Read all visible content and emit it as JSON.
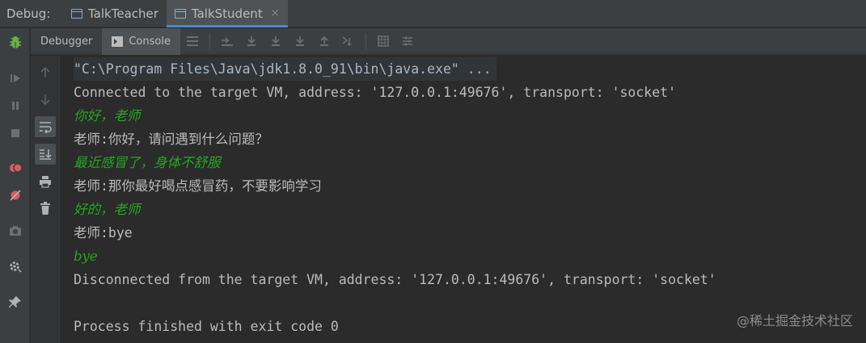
{
  "topbar": {
    "label": "Debug:",
    "tabs": [
      {
        "title": "TalkTeacher",
        "active": false,
        "closable": false
      },
      {
        "title": "TalkStudent",
        "active": true,
        "closable": true
      }
    ],
    "close_glyph": "×"
  },
  "toolbar": {
    "debugger_label": "Debugger",
    "console_label": "Console",
    "icons": [
      "menu-icon",
      "show-execution-point-icon",
      "step-over-icon",
      "step-into-icon",
      "force-step-into-icon",
      "step-out-icon",
      "run-to-cursor-icon",
      "evaluate-expression-icon",
      "trace-icon"
    ]
  },
  "leftbar": {
    "icons": [
      "bug-icon",
      "resume-icon",
      "pause-icon",
      "stop-icon",
      "view-breakpoints-icon",
      "mute-breakpoints-icon",
      "camera-icon",
      "settings-icon",
      "pin-icon"
    ]
  },
  "gutter": {
    "icons": [
      "up-arrow-icon",
      "down-arrow-icon",
      "soft-wrap-icon",
      "scroll-to-end-icon",
      "print-icon",
      "clear-icon"
    ]
  },
  "console": {
    "lines": [
      {
        "text": "\"C:\\Program Files\\Java\\jdk1.8.0_91\\bin\\java.exe\" ...",
        "kind": "cmd"
      },
      {
        "text": "Connected to the target VM, address: '127.0.0.1:49676', transport: 'socket'",
        "kind": "out"
      },
      {
        "text": "你好，老师",
        "kind": "inp"
      },
      {
        "text": "老师:你好，请问遇到什么问题？",
        "kind": "out"
      },
      {
        "text": "最近感冒了，身体不舒服",
        "kind": "inp"
      },
      {
        "text": "老师:那你最好喝点感冒药，不要影响学习",
        "kind": "out"
      },
      {
        "text": "好的，老师",
        "kind": "inp"
      },
      {
        "text": "老师:bye",
        "kind": "out"
      },
      {
        "text": "bye",
        "kind": "inp"
      },
      {
        "text": "Disconnected from the target VM, address: '127.0.0.1:49676', transport: 'socket'",
        "kind": "out"
      },
      {
        "text": "",
        "kind": "out"
      },
      {
        "text": "Process finished with exit code 0",
        "kind": "out"
      }
    ]
  },
  "watermark": "@稀土掘金技术社区",
  "colors": {
    "background": "#2b2b2b",
    "panel": "#3c3f41",
    "user_input": "#26a621",
    "output": "#bbbbbb",
    "accent": "#4a88c7"
  }
}
